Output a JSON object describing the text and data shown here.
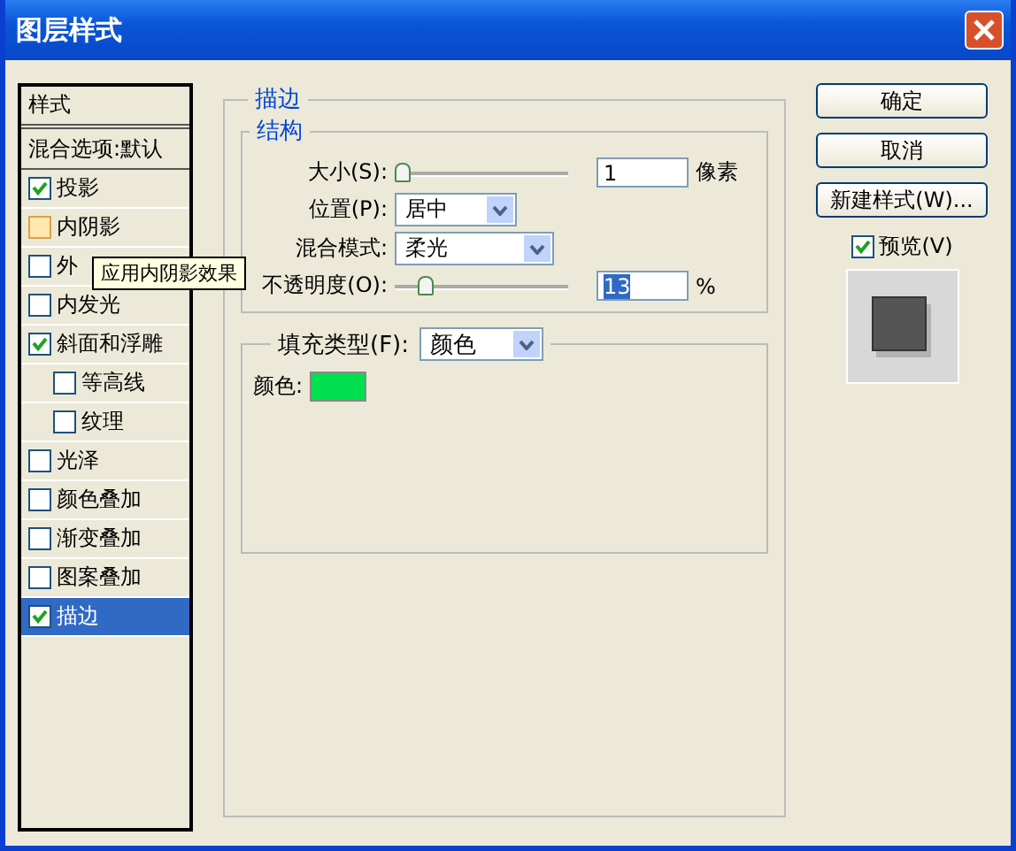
{
  "window": {
    "title": "图层样式"
  },
  "styles_list": {
    "header": "样式",
    "blend_options": "混合选项:默认",
    "items": [
      {
        "label": "投影",
        "checked": true,
        "selected": false,
        "hovered": false,
        "indented": false
      },
      {
        "label": "内阴影",
        "checked": false,
        "selected": false,
        "hovered": true,
        "indented": false
      },
      {
        "label": "外",
        "checked": false,
        "selected": false,
        "hovered": false,
        "indented": false
      },
      {
        "label": "内发光",
        "checked": false,
        "selected": false,
        "hovered": false,
        "indented": false
      },
      {
        "label": "斜面和浮雕",
        "checked": true,
        "selected": false,
        "hovered": false,
        "indented": false
      },
      {
        "label": "等高线",
        "checked": false,
        "selected": false,
        "hovered": false,
        "indented": true
      },
      {
        "label": "纹理",
        "checked": false,
        "selected": false,
        "hovered": false,
        "indented": true
      },
      {
        "label": "光泽",
        "checked": false,
        "selected": false,
        "hovered": false,
        "indented": false
      },
      {
        "label": "颜色叠加",
        "checked": false,
        "selected": false,
        "hovered": false,
        "indented": false
      },
      {
        "label": "渐变叠加",
        "checked": false,
        "selected": false,
        "hovered": false,
        "indented": false
      },
      {
        "label": "图案叠加",
        "checked": false,
        "selected": false,
        "hovered": false,
        "indented": false
      },
      {
        "label": "描边",
        "checked": true,
        "selected": true,
        "hovered": false,
        "indented": false
      }
    ],
    "tooltip": "应用内阴影效果"
  },
  "stroke": {
    "title": "描边",
    "structure": {
      "title": "结构",
      "size": {
        "label": "大小(S):",
        "level": 0,
        "value": "1",
        "unit": "像素"
      },
      "position": {
        "label": "位置(P):",
        "value": "居中"
      },
      "blend_mode": {
        "label": "混合模式:",
        "value": "柔光"
      },
      "opacity": {
        "label": "不透明度(O):",
        "level": 0.13,
        "value": "13",
        "unit": "%"
      }
    },
    "fill": {
      "label": "填充类型(F):",
      "value": "颜色",
      "color_label": "颜色:",
      "color": "#00e050"
    }
  },
  "buttons": [
    "确定",
    "取消",
    "新建样式(W)..."
  ],
  "preview": {
    "label": "预览(V)",
    "checked": true
  }
}
